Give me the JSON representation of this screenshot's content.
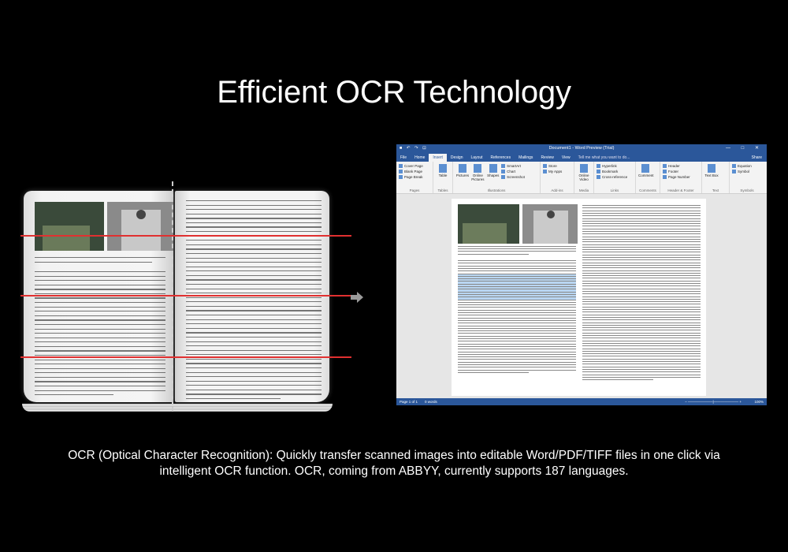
{
  "headline": "Efficient OCR Technology",
  "caption_line1": "OCR (Optical Character Recognition): Quickly transfer scanned images into editable Word/PDF/TIFF files in one click via",
  "caption_line2": "intelligent OCR function. OCR, coming from ABBYY, currently supports 187 languages.",
  "word": {
    "window_title": "Document1 - Word Preview (Trial)",
    "window_controls": "— □ ✕",
    "tabs": [
      "File",
      "Home",
      "Insert",
      "Design",
      "Layout",
      "References",
      "Mailings",
      "Review",
      "View"
    ],
    "active_tab": "Insert",
    "tell_me": "Tell me what you want to do...",
    "share": "Share",
    "groups": {
      "pages": {
        "label": "Pages",
        "items": [
          "Cover Page",
          "Blank Page",
          "Page Break"
        ]
      },
      "tables": {
        "label": "Tables",
        "button": "Table"
      },
      "illustrations": {
        "label": "Illustrations",
        "buttons": [
          "Pictures",
          "Online Pictures",
          "Shapes"
        ],
        "items": [
          "SmartArt",
          "Chart",
          "Screenshot"
        ]
      },
      "addins": {
        "label": "Add-ins",
        "items": [
          "Store",
          "My Apps"
        ]
      },
      "media": {
        "label": "Media",
        "button": "Online Video"
      },
      "links": {
        "label": "Links",
        "items": [
          "Hyperlink",
          "Bookmark",
          "Cross-reference"
        ]
      },
      "comments": {
        "label": "Comments",
        "button": "Comment"
      },
      "header_footer": {
        "label": "Header & Footer",
        "items": [
          "Header",
          "Footer",
          "Page Number"
        ]
      },
      "text": {
        "label": "Text",
        "button": "Text Box"
      },
      "symbols": {
        "label": "Symbols",
        "items": [
          "Equation",
          "Symbol"
        ]
      }
    },
    "status": {
      "page": "Page 1 of 1",
      "words": "0 words",
      "zoom": "100%"
    }
  },
  "colors": {
    "word_blue": "#2b579a",
    "scan_red": "#e03030",
    "highlight": "#b9d6f2"
  }
}
